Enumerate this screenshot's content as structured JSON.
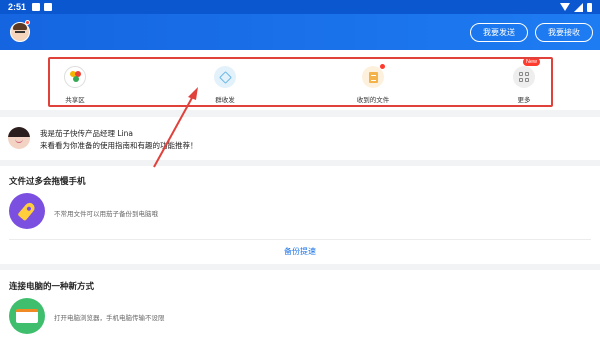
{
  "status_bar": {
    "time": "2:51"
  },
  "header": {
    "send_button": "我要发送",
    "receive_button": "我要接收"
  },
  "quick_actions": [
    {
      "label": "共享区",
      "icon": "share-zone-icon"
    },
    {
      "label": "群收发",
      "icon": "group-transfer-icon"
    },
    {
      "label": "收到的文件",
      "icon": "received-files-icon"
    },
    {
      "label": "更多",
      "icon": "more-grid-icon",
      "badge": "New"
    }
  ],
  "promo": {
    "line1": "我是茄子快传产品经理 Lina",
    "line2": "来看看为你准备的使用指南和有趣的功能推荐！"
  },
  "backup_section": {
    "title": "文件过多会拖慢手机",
    "description": "不常用文件可以用茄子备份到电脑哦",
    "link": "备份提速"
  },
  "connect_section": {
    "title": "连接电脑的一种新方式",
    "description": "打开电脑浏览器，手机电脑传输不设限"
  },
  "colors": {
    "header_blue": "#1565e0",
    "highlight_red": "#e0413b",
    "link_blue": "#1a73e8"
  }
}
